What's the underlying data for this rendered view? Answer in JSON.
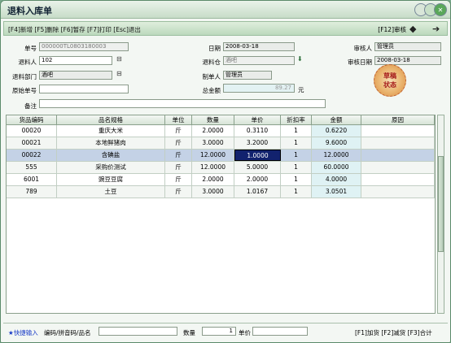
{
  "window": {
    "title": "退料入库单"
  },
  "toolbar": {
    "shortcuts": "[F4]新增 [F5]删除 [F6]暂存 [F7]打印 [Esc]退出",
    "audit": "[F12]审核",
    "prev_icon": "left-arrow-icon",
    "next_icon": "right-arrow-icon"
  },
  "form": {
    "doc_no_label": "单号",
    "doc_no": "000000TL0803180003",
    "date_label": "日期",
    "date": "2008-03-18",
    "auditor_label": "审核人",
    "auditor": "管理员",
    "returner_label": "退料人",
    "returner": "102",
    "warehouse_label": "退料仓",
    "warehouse": "酒吧",
    "audit_date_label": "审核日期",
    "audit_date": "2008-03-18",
    "dept_label": "退料部门",
    "dept": "酒吧",
    "maker_label": "制单人",
    "maker": "管理员",
    "orig_no_label": "原始单号",
    "orig_no": "",
    "total_label": "总金额",
    "total": "89.27",
    "total_unit": "元",
    "note_label": "备注",
    "note": ""
  },
  "seal": {
    "line1": "草稿",
    "line2": "状态"
  },
  "table": {
    "columns": [
      "货品编码",
      "品名规格",
      "单位",
      "数量",
      "单价",
      "折扣率",
      "金额",
      "原因"
    ],
    "rows": [
      [
        "00020",
        "重庆大米",
        "斤",
        "2.0000",
        "0.3110",
        "1",
        "0.6220",
        ""
      ],
      [
        "00021",
        "本地鲜猪肉",
        "斤",
        "3.0000",
        "3.2000",
        "1",
        "9.6000",
        ""
      ],
      [
        "00022",
        "含碘盐",
        "斤",
        "12.0000",
        "1.0000",
        "1",
        "12.0000",
        ""
      ],
      [
        "555",
        "采购价测试",
        "斤",
        "12.0000",
        "5.0000",
        "1",
        "60.0000",
        ""
      ],
      [
        "6001",
        "豌豆豆腐",
        "斤",
        "2.0000",
        "2.0000",
        "1",
        "4.0000",
        ""
      ],
      [
        "789",
        "土豆",
        "斤",
        "3.0000",
        "1.0167",
        "1",
        "3.0501",
        ""
      ]
    ],
    "selected_row": 2
  },
  "status": {
    "quick_input": "★快捷输入",
    "code_label": "编码/拼音码/品名",
    "code_value": "",
    "qty_label": "数量",
    "qty_value": "1",
    "price_label": "单价",
    "price_value": "",
    "hints": "[F1]加货 [F2]减货 [F3]合计"
  }
}
